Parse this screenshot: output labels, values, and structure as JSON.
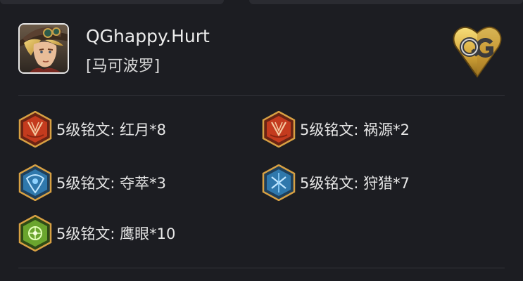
{
  "player": {
    "name": "QGhappy.Hurt",
    "hero": "[马可波罗]",
    "team_logo_text": "QG"
  },
  "runes": [
    {
      "label": "5级铭文: 红月*8",
      "color": "red",
      "icon": "red-rune-icon"
    },
    {
      "label": "5级铭文: 祸源*2",
      "color": "red",
      "icon": "red-rune-icon"
    },
    {
      "label": "5级铭文: 夺萃*3",
      "color": "blue",
      "icon": "blue-rune-icon"
    },
    {
      "label": "5级铭文: 狩猎*7",
      "color": "blue",
      "icon": "blue-rune-icon"
    },
    {
      "label": "5级铭文: 鹰眼*10",
      "color": "green",
      "icon": "green-rune-icon"
    }
  ],
  "colors": {
    "background": "#1c1d22",
    "text": "#e6e6e6",
    "red_rune": "#c63a1e",
    "blue_rune": "#2b6ea3",
    "green_rune": "#5f9b2a",
    "gold": "#d4a640"
  }
}
